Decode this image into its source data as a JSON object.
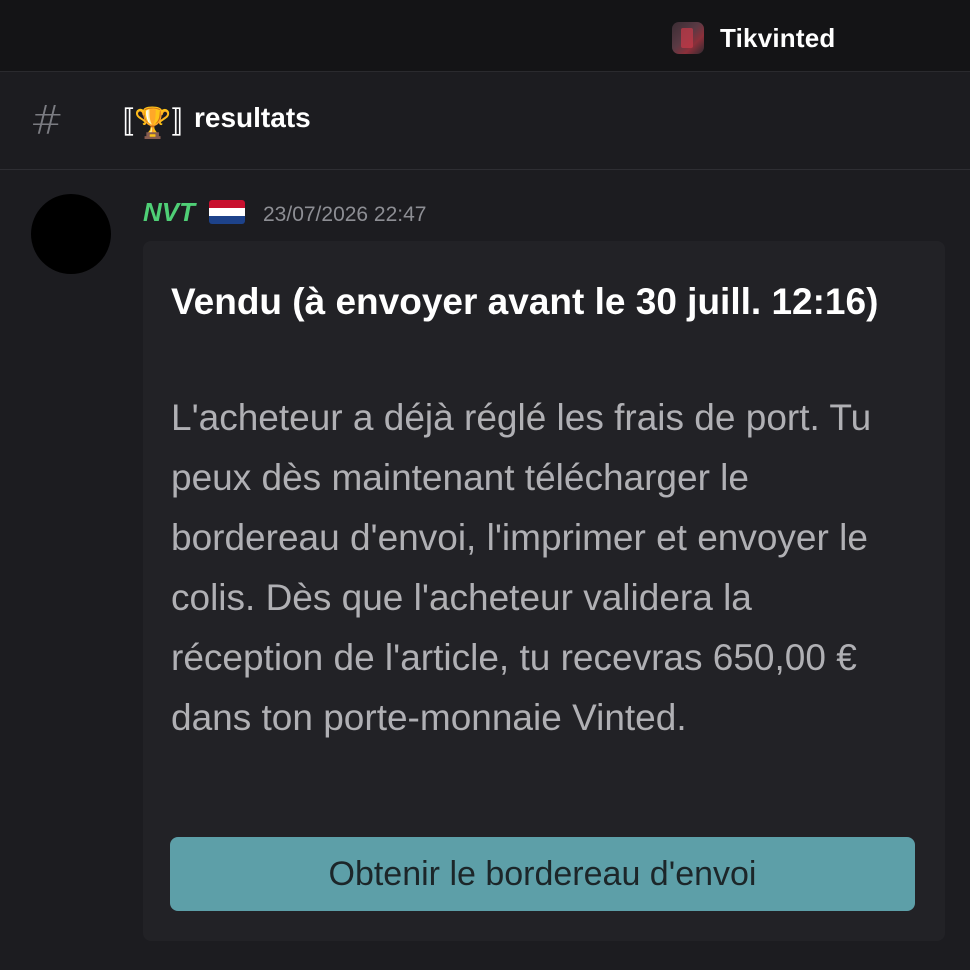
{
  "server": {
    "name": "Tikvinted",
    "icon": "server-icon"
  },
  "channel": {
    "hash": "#",
    "decor_left": "〚",
    "decor_emoji": "🏆",
    "decor_right": "〛",
    "name": "resultats"
  },
  "message": {
    "author": "NVT",
    "flag": "netherlands-flag",
    "timestamp": "23/07/2026 22:47",
    "embed": {
      "title": "Vendu (à envoyer avant le 30 juill. 12:16)",
      "description": "L'acheteur a déjà réglé les frais de port. Tu peux dès maintenant télécharger le bordereau d'envoi, l'imprimer et envoyer le colis. Dès que l'acheteur validera la réception de l'article, tu recevras 650,00 € dans ton porte-monnaie Vinted.",
      "button_label": "Obtenir le bordereau d'envoi"
    }
  },
  "colors": {
    "author": "#4fcf76",
    "button": "#5d9fa8",
    "background": "#1c1c20",
    "embed": "#222226"
  }
}
